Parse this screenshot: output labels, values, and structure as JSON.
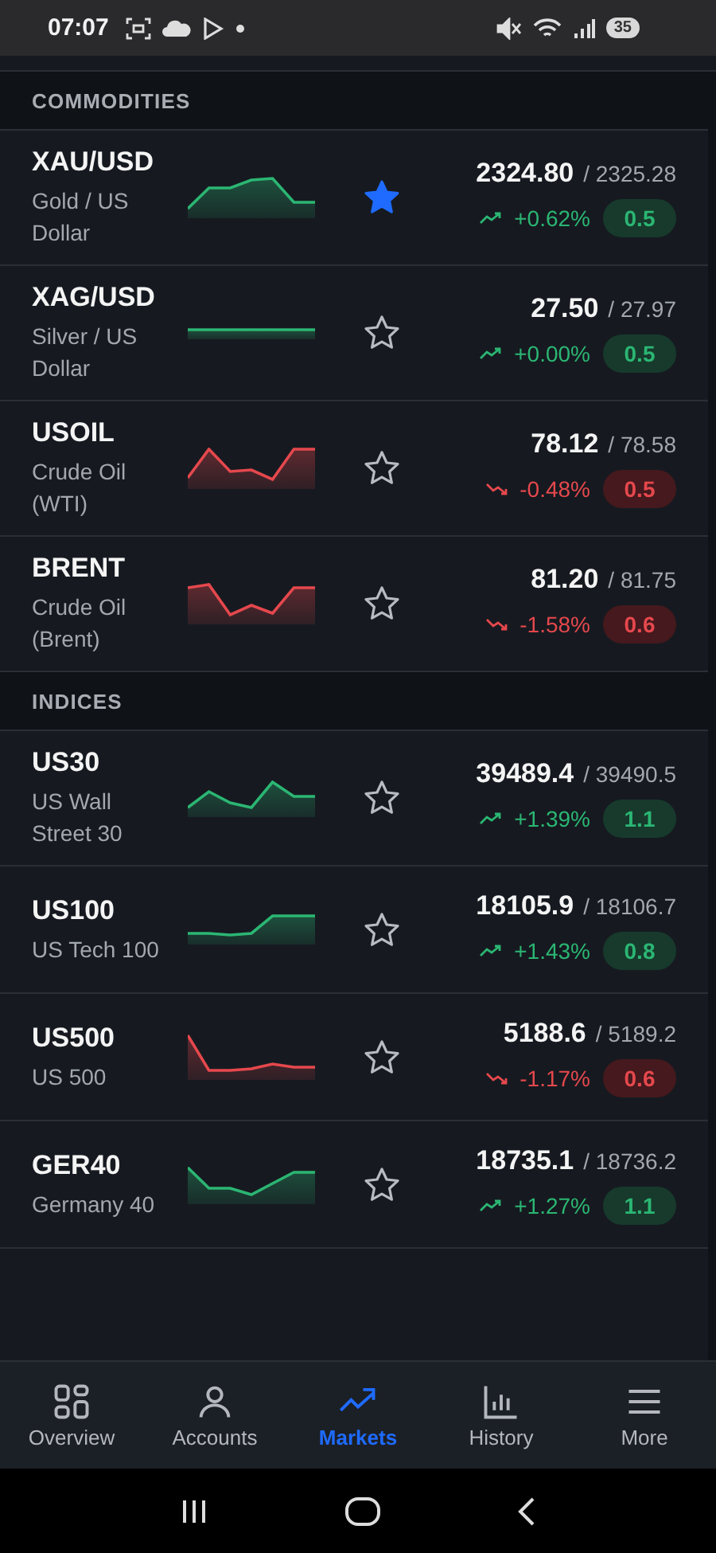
{
  "status_bar": {
    "time": "07:07",
    "battery": "35"
  },
  "sections": [
    {
      "title": "COMMODITIES",
      "rows": [
        {
          "symbol": "XAU/USD",
          "description": "Gold / US Dollar",
          "favorite": true,
          "price": "2324.80",
          "ask": "/ 2325.28",
          "kind": "up",
          "change": "+0.62%",
          "spread": "0.5"
        },
        {
          "symbol": "XAG/USD",
          "description": "Silver / US Dollar",
          "favorite": false,
          "price": "27.50",
          "ask": "/ 27.97",
          "kind": "up",
          "change": "+0.00%",
          "spread": "0.5"
        },
        {
          "symbol": "USOIL",
          "description": "Crude Oil (WTI)",
          "favorite": false,
          "price": "78.12",
          "ask": "/ 78.58",
          "kind": "down",
          "change": "-0.48%",
          "spread": "0.5"
        },
        {
          "symbol": "BRENT",
          "description": "Crude Oil (Brent)",
          "favorite": false,
          "price": "81.20",
          "ask": "/ 81.75",
          "kind": "down",
          "change": "-1.58%",
          "spread": "0.6"
        }
      ]
    },
    {
      "title": "INDICES",
      "rows": [
        {
          "symbol": "US30",
          "description": "US Wall Street 30",
          "favorite": false,
          "price": "39489.4",
          "ask": "/ 39490.5",
          "kind": "up",
          "change": "+1.39%",
          "spread": "1.1"
        },
        {
          "symbol": "US100",
          "description": "US Tech 100",
          "favorite": false,
          "price": "18105.9",
          "ask": "/ 18106.7",
          "kind": "up",
          "change": "+1.43%",
          "spread": "0.8"
        },
        {
          "symbol": "US500",
          "description": "US 500",
          "favorite": false,
          "price": "5188.6",
          "ask": "/ 5189.2",
          "kind": "down",
          "change": "-1.17%",
          "spread": "0.6"
        },
        {
          "symbol": "GER40",
          "description": "Germany 40",
          "favorite": false,
          "price": "18735.1",
          "ask": "/ 18736.2",
          "kind": "up",
          "change": "+1.27%",
          "spread": "1.1"
        }
      ]
    }
  ],
  "bottom_nav": [
    {
      "kind": "overview",
      "label": "Overview",
      "selected": false
    },
    {
      "kind": "accounts",
      "label": "Accounts",
      "selected": false
    },
    {
      "kind": "markets",
      "label": "Markets",
      "selected": true
    },
    {
      "kind": "history",
      "label": "History",
      "selected": false
    },
    {
      "kind": "more",
      "label": "More",
      "selected": false
    }
  ]
}
